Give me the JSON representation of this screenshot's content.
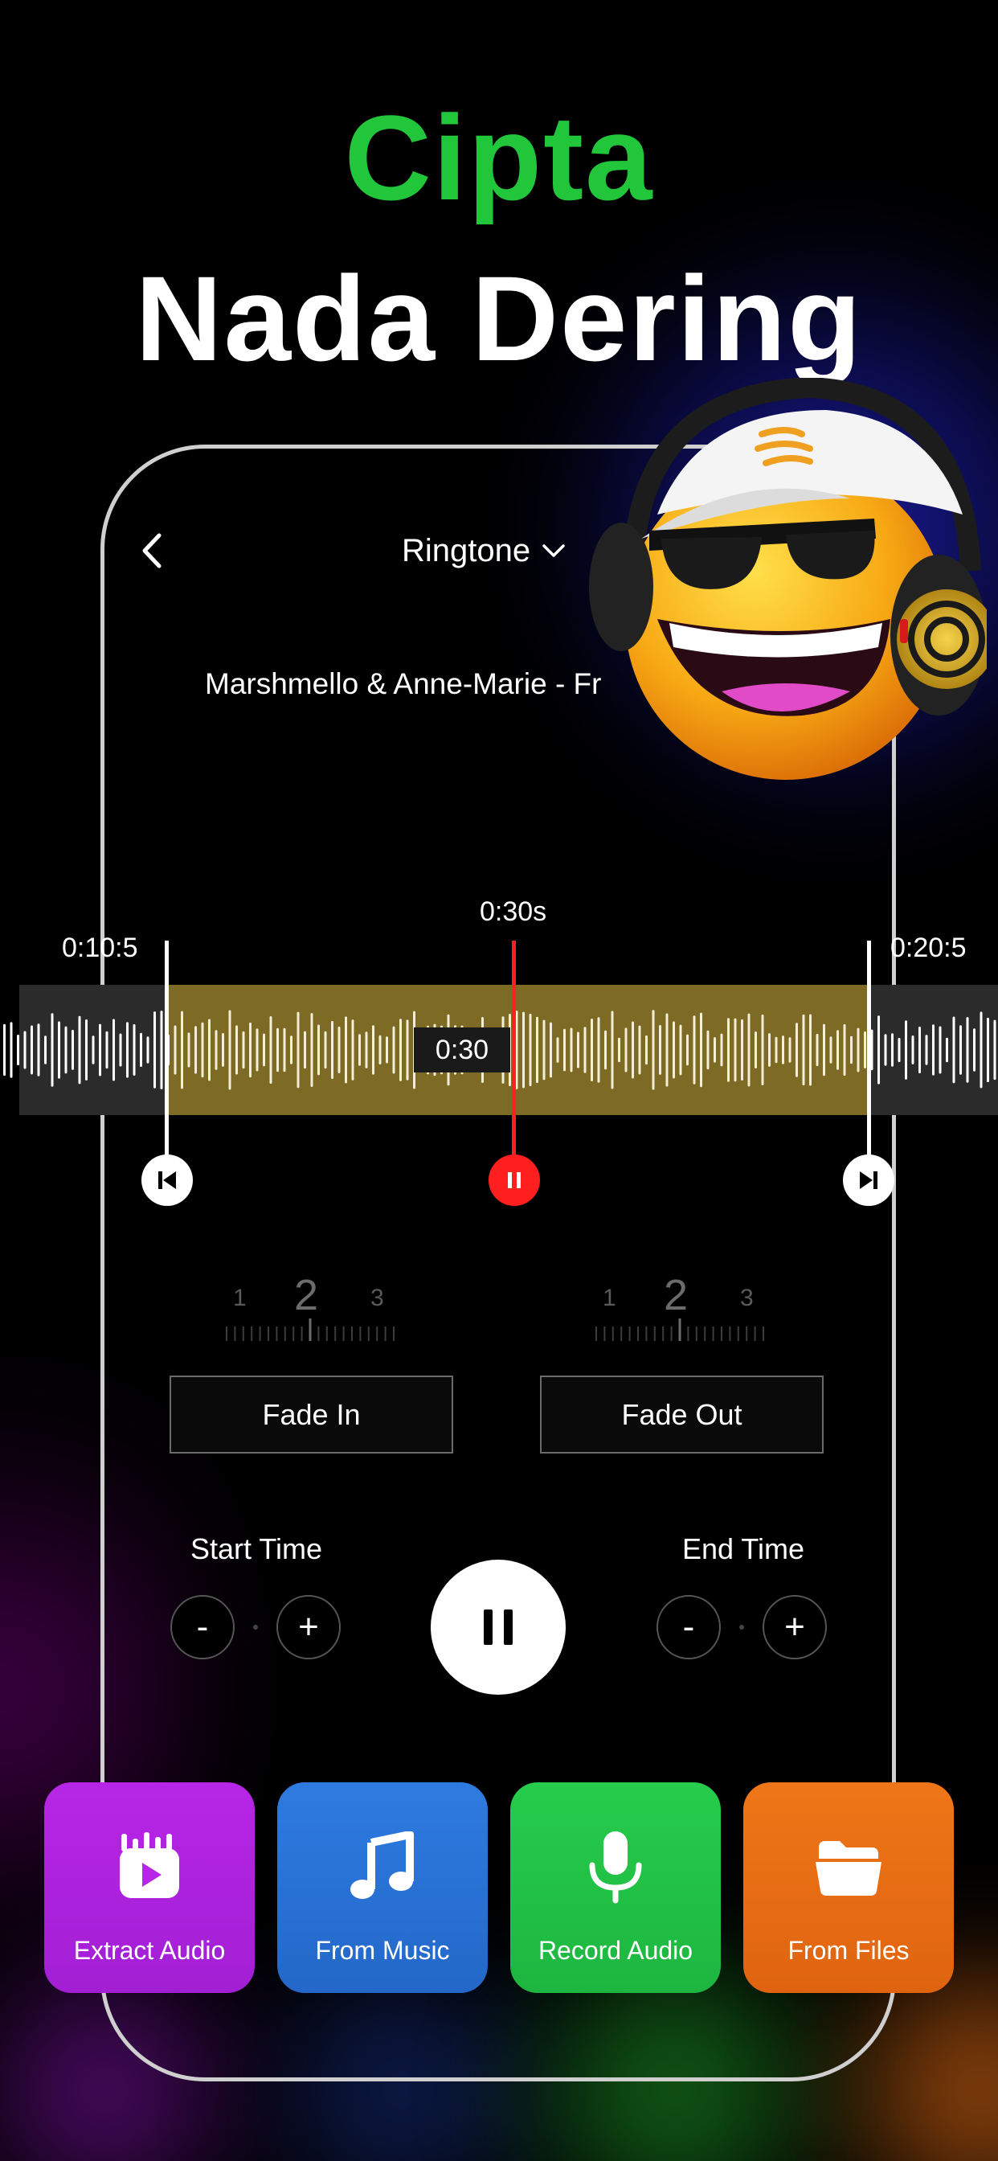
{
  "headline": {
    "line1": "Cipta",
    "line2": "Nada Dering"
  },
  "header": {
    "back_icon": "chevron-left-icon",
    "title": "Ringtone",
    "dropdown_icon": "chevron-down-icon"
  },
  "song": {
    "title": "Marshmello & Anne-Marie - Fr"
  },
  "timeline": {
    "start_label": "0:10:5",
    "end_label": "0:20:5",
    "playhead_label": "0:30s",
    "badge": "0:30"
  },
  "fade_in": {
    "label": "Fade In",
    "dial": [
      "1",
      "2",
      "3"
    ]
  },
  "fade_out": {
    "label": "Fade Out",
    "dial": [
      "1",
      "2",
      "3"
    ]
  },
  "start_time": {
    "label": "Start Time",
    "minus": "-",
    "plus": "+"
  },
  "end_time": {
    "label": "End Time",
    "minus": "-",
    "plus": "+"
  },
  "tiles": [
    {
      "label": "Extract Audio",
      "icon": "extract-audio-icon",
      "color": "#b726e6"
    },
    {
      "label": "From Music",
      "icon": "music-note-icon",
      "color": "#2e7be0"
    },
    {
      "label": "Record Audio",
      "icon": "microphone-icon",
      "color": "#26cc4c"
    },
    {
      "label": "From Files",
      "icon": "folder-icon",
      "color": "#ef7618"
    }
  ],
  "colors": {
    "accent_green": "#22c63b",
    "playhead_red": "#ff1f1f",
    "selection": "#7d6a25"
  }
}
